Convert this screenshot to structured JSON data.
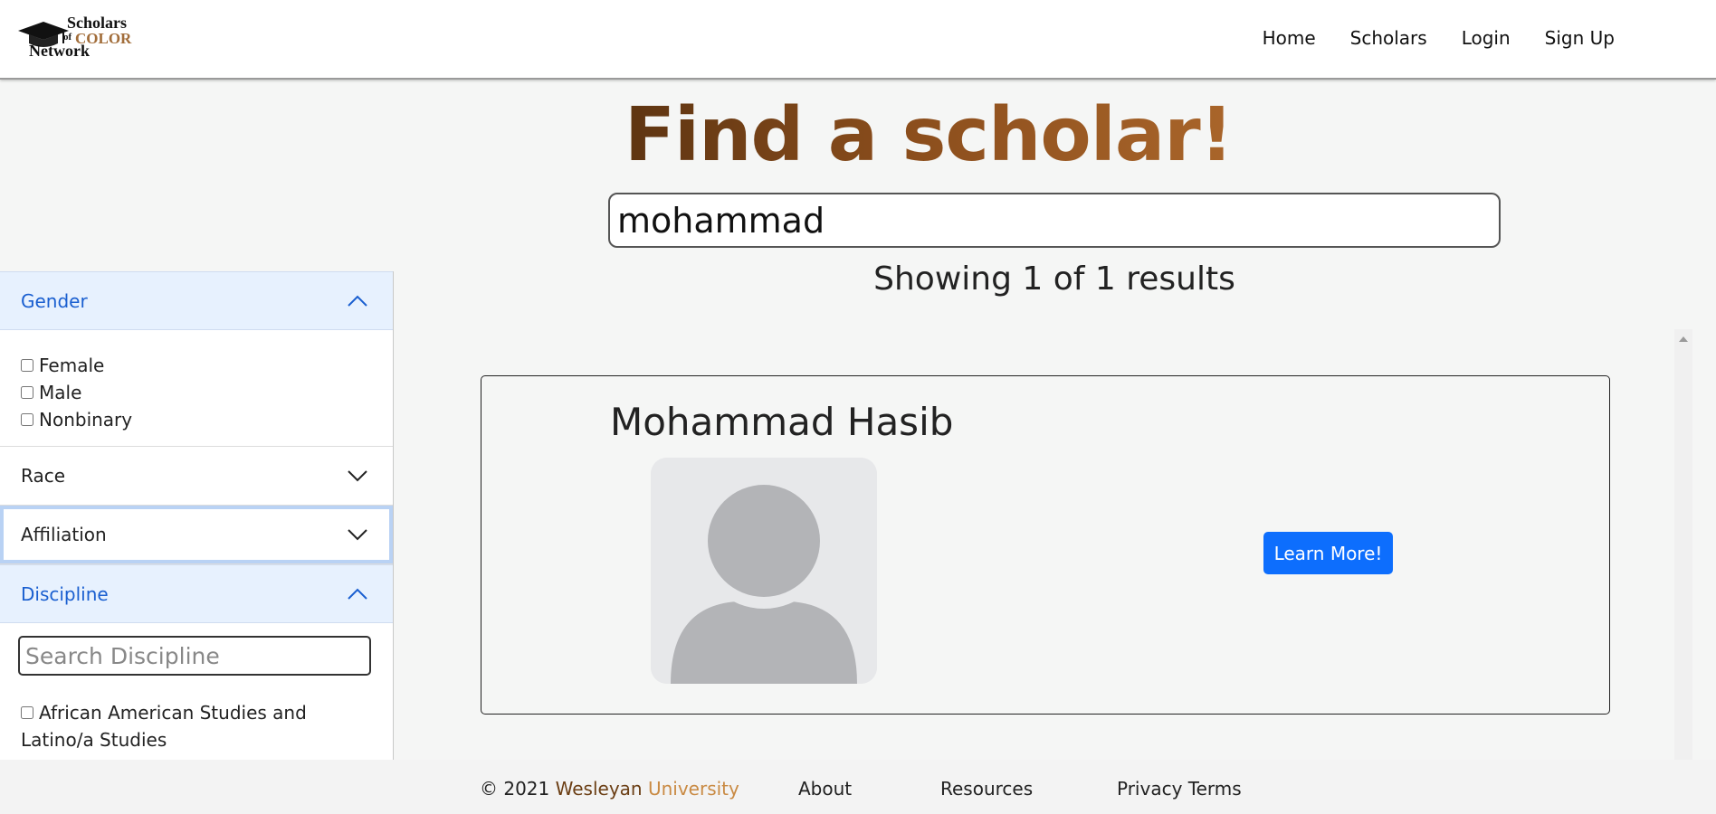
{
  "nav": {
    "logo": {
      "line1": "Scholars",
      "line2": "of",
      "line3": "COLOR",
      "line4": "Network"
    },
    "links": [
      "Home",
      "Scholars",
      "Login",
      "Sign Up"
    ]
  },
  "main": {
    "title": "Find a scholar!",
    "search_value": "mohammad",
    "result_count": "Showing 1 of 1 results"
  },
  "sidebar": {
    "gender": {
      "label": "Gender",
      "options": [
        "Female",
        "Male",
        "Nonbinary"
      ]
    },
    "race": {
      "label": "Race"
    },
    "affiliation": {
      "label": "Affiliation"
    },
    "discipline": {
      "label": "Discipline",
      "search_placeholder": "Search Discipline",
      "items": [
        "African American Studies and Latino/a Studies"
      ]
    }
  },
  "results": [
    {
      "name": "Mohammad Hasib",
      "button": "Learn More!"
    }
  ],
  "footer": {
    "copyright_prefix": "© 2021",
    "wesleyan": "Wesleyan",
    "university": "University",
    "links": [
      "About",
      "Resources",
      "Privacy Terms"
    ]
  },
  "colors": {
    "accent_blue": "#0d6efd",
    "title_brown": "#8a4d1c",
    "open_header_bg": "#e7f1fe"
  },
  "icons": [
    "graduation-cap-icon",
    "chevron-up-icon",
    "chevron-down-icon",
    "avatar-placeholder-icon"
  ]
}
